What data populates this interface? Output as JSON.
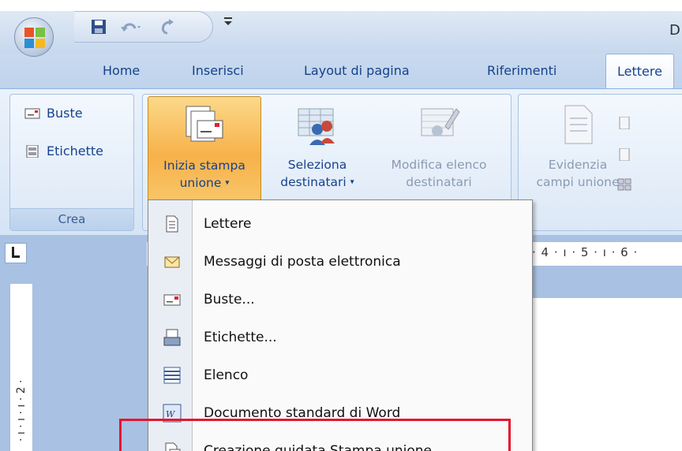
{
  "title_bar": {
    "window_title_fragment": "D"
  },
  "tabs": [
    "Home",
    "Inserisci",
    "Layout di pagina",
    "Riferimenti",
    "Lettere"
  ],
  "active_tab": "Lettere",
  "ribbon": {
    "crea_group": {
      "label": "Crea",
      "buttons": [
        "Buste",
        "Etichette"
      ]
    },
    "start_group": {
      "inizia": {
        "line1": "Inizia stampa",
        "line2": "unione"
      },
      "seleziona": {
        "line1": "Seleziona",
        "line2": "destinatari"
      },
      "modifica": {
        "line1": "Modifica elenco",
        "line2": "destinatari"
      }
    },
    "write_group": {
      "evidenzia": {
        "line1": "Evidenzia",
        "line2": "campi unione"
      }
    }
  },
  "ruler": {
    "text": "· 4 · ı · 5 · ı · 6 ·",
    "vertical_text": "· ı · ı · ı · 2 ·"
  },
  "menu": {
    "items": [
      {
        "label": "Lettere",
        "icon": "document-icon"
      },
      {
        "label": "Messaggi di posta elettronica",
        "icon": "email-icon"
      },
      {
        "label": "Buste...",
        "icon": "envelope-icon"
      },
      {
        "label": "Etichette...",
        "icon": "labels-icon"
      },
      {
        "label": "Elenco",
        "icon": "list-icon"
      },
      {
        "label": "Documento standard di Word",
        "icon": "word-document-icon"
      },
      {
        "label": "Creazione guidata Stampa unione...",
        "icon": "wizard-icon"
      }
    ],
    "highlighted_item": "Creazione guidata Stampa unione..."
  },
  "colors": {
    "ribbon_text": "#15428b",
    "highlight_border": "#e5162e",
    "pressed_button": "#f7b14a"
  }
}
